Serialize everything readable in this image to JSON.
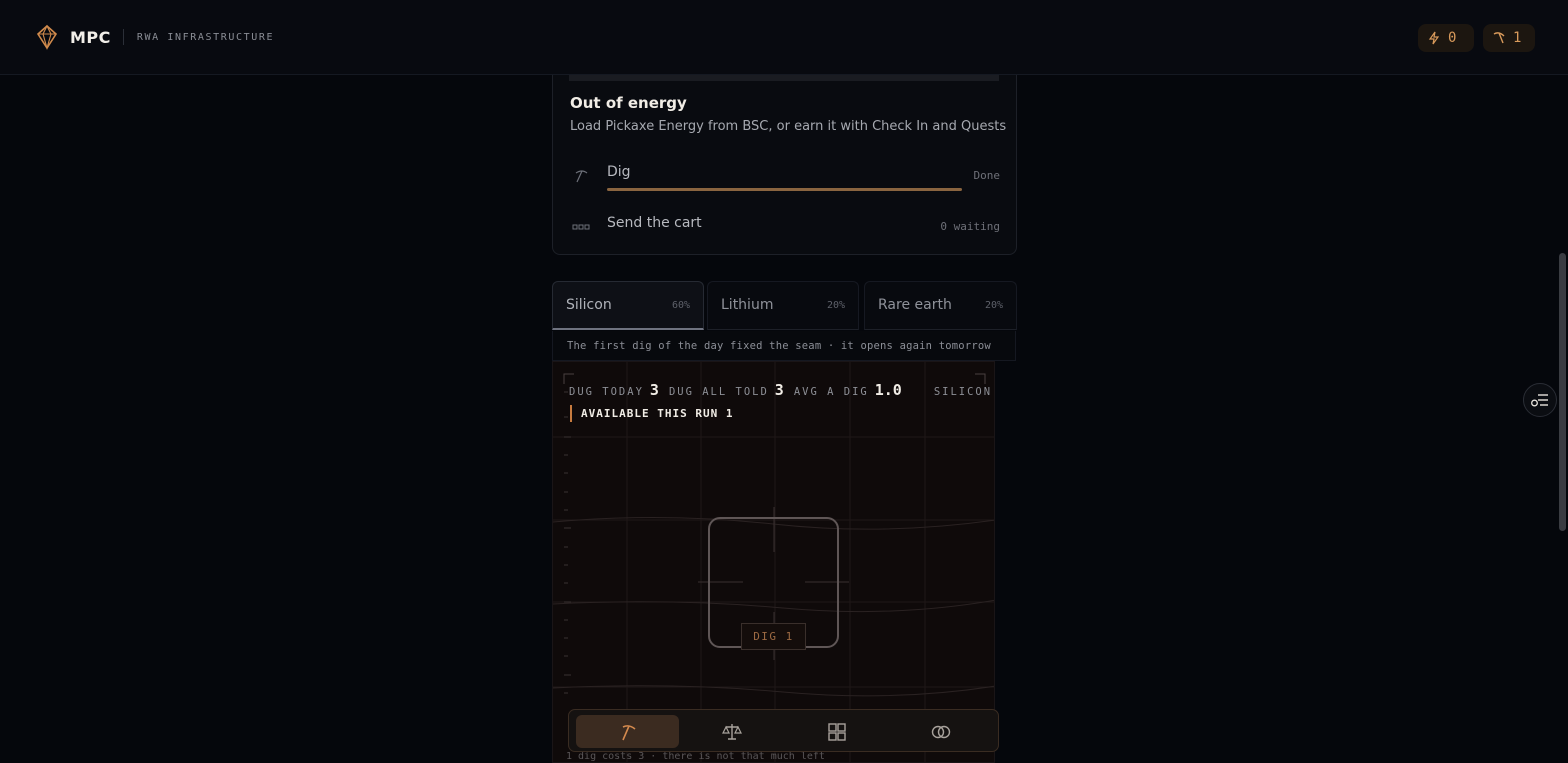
{
  "header": {
    "brand_name": "MPC",
    "brand_tagline": "RWA INFRASTRUCTURE",
    "energy_count": "0",
    "pickaxe_count": "1"
  },
  "energy_card": {
    "title": "Out of energy",
    "subtitle": "Load Pickaxe Energy from BSC, or earn it with Check In and Quests",
    "steps": [
      {
        "label": "Dig",
        "status": "Done",
        "icon": "pickaxe-icon",
        "progress": 1.0
      },
      {
        "label": "Send the cart",
        "status": "0 waiting",
        "icon": "cart-icon"
      }
    ]
  },
  "tabs": [
    {
      "label": "Silicon",
      "pct": "60%",
      "active": true
    },
    {
      "label": "Lithium",
      "pct": "20%",
      "active": false
    },
    {
      "label": "Rare earth",
      "pct": "20%",
      "active": false
    }
  ],
  "note": "The first dig of the day fixed the seam · it opens again tomorrow",
  "panel": {
    "dug_today_label": "DUG TODAY",
    "dug_today": "3",
    "dug_all_label": "DUG ALL TOLD",
    "dug_all": "3",
    "avg_label": "AVG A DIG",
    "avg": "1.0",
    "material": "SILICON",
    "available": "AVAILABLE THIS RUN 1",
    "dig_button": "DIG 1",
    "footer": "1 dig costs 3 · there is not that much left"
  },
  "bottom_nav": [
    "pickaxe-icon",
    "scale-icon",
    "grid-icon",
    "rings-icon"
  ],
  "colors": {
    "accent": "#c77b3f",
    "background": "#05070c",
    "panel": "#0f0a0a"
  }
}
